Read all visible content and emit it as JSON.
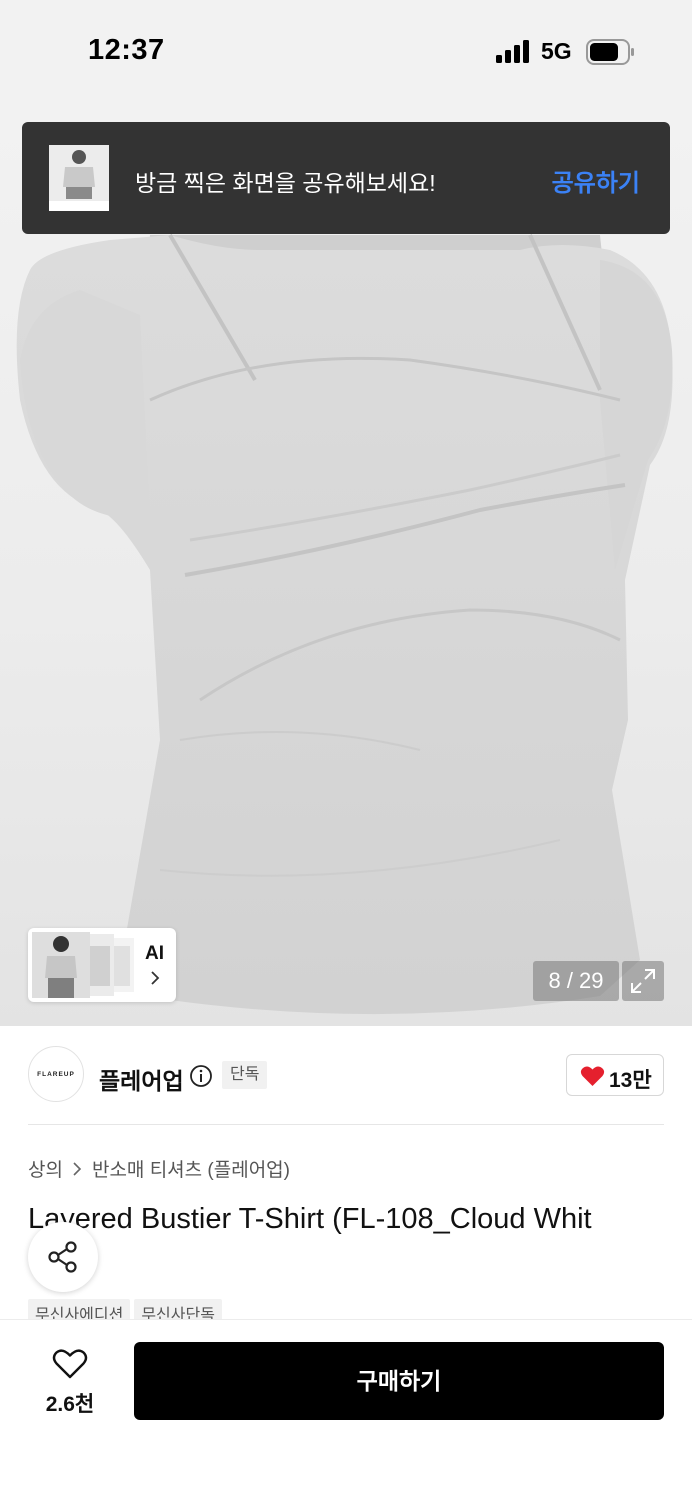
{
  "status_bar": {
    "time": "12:37",
    "network": "5G"
  },
  "share_toast": {
    "message": "방금 찍은 화면을 공유해보세요!",
    "action_label": "공유하기"
  },
  "gallery": {
    "ai_label": "AI",
    "counter": "8 / 29"
  },
  "brand": {
    "logo_text": "FLAREUP",
    "name": "플레어업",
    "badge": "단독",
    "likes": "13만"
  },
  "breadcrumb": {
    "category": "상의",
    "subcategory": "반소매 티셔츠 (플레어업)"
  },
  "product": {
    "title": "Layered Bustier T-Shirt (FL-108_Cloud Whit"
  },
  "tags": [
    "무신사에디션",
    "무신사단독"
  ],
  "bottom_bar": {
    "wish_count": "2.6천",
    "buy_label": "구매하기"
  },
  "colors": {
    "accent_blue": "#3b82f6",
    "heart_red": "#e5202e",
    "toast_bg": "#333333",
    "buy_bg": "#000000"
  }
}
